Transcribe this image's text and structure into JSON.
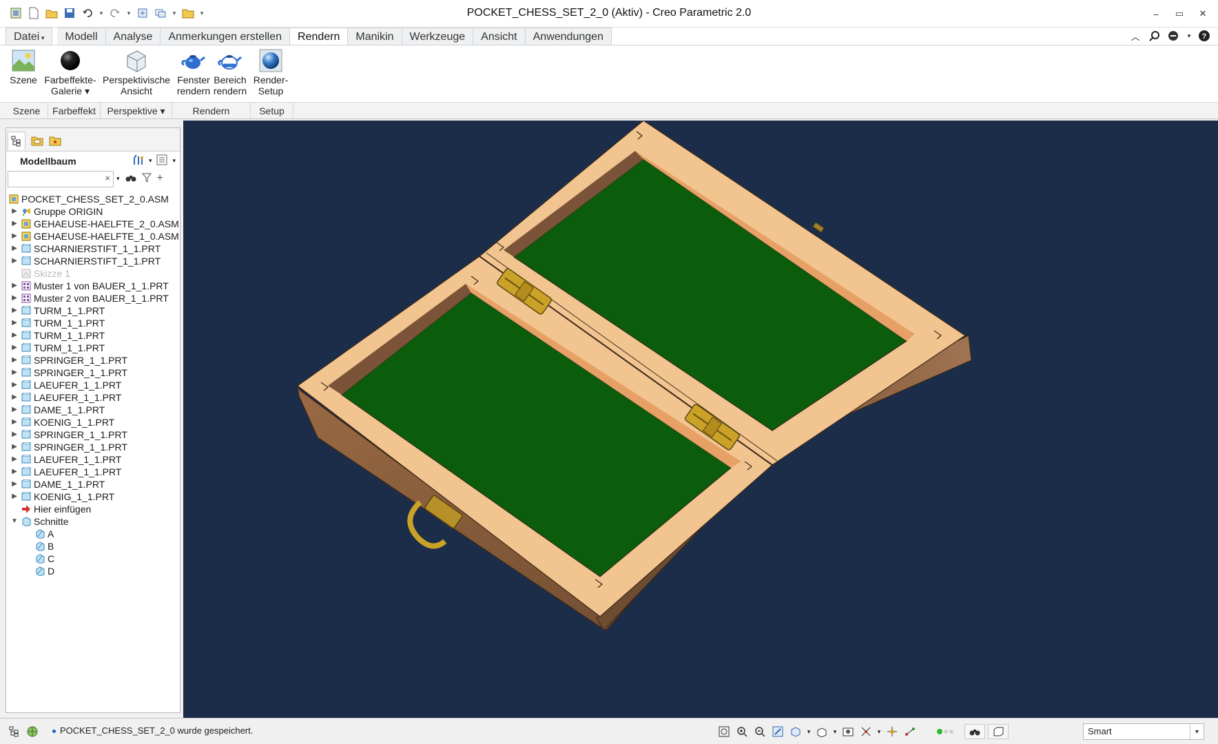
{
  "window": {
    "title": "POCKET_CHESS_SET_2_0 (Aktiv) - Creo Parametric 2.0"
  },
  "ribbon_tabs": [
    {
      "label": "Datei",
      "name": "tab-datei"
    },
    {
      "label": "Modell",
      "name": "tab-modell"
    },
    {
      "label": "Analyse",
      "name": "tab-analyse"
    },
    {
      "label": "Anmerkungen erstellen",
      "name": "tab-anmerkungen"
    },
    {
      "label": "Rendern",
      "name": "tab-rendern"
    },
    {
      "label": "Manikin",
      "name": "tab-manikin"
    },
    {
      "label": "Werkzeuge",
      "name": "tab-werkzeuge"
    },
    {
      "label": "Ansicht",
      "name": "tab-ansicht"
    },
    {
      "label": "Anwendungen",
      "name": "tab-anwendungen"
    }
  ],
  "active_tab": "Rendern",
  "ribbon_buttons": {
    "szene": "Szene",
    "farbeffekte": "Farbeffekte-\nGalerie ▾",
    "perspektivische": "Perspektivische\nAnsicht",
    "fenster_rendern": "Fenster\nrendern",
    "bereich_rendern": "Bereich\nrendern",
    "render_setup": "Render-\nSetup"
  },
  "ribbon_groups": {
    "szene": "Szene",
    "farbeffekt": "Farbeffekt",
    "perspektive": "Perspektive ▾",
    "rendern": "Rendern",
    "setup": "Setup"
  },
  "panel": {
    "title": "Modellbaum",
    "search_value": "",
    "clear": "×"
  },
  "tree": [
    {
      "label": "POCKET_CHESS_SET_2_0.ASM",
      "type": "asm",
      "level": 0,
      "root": true
    },
    {
      "label": "Gruppe ORIGIN",
      "type": "group",
      "level": 1
    },
    {
      "label": "GEHAEUSE-HAELFTE_2_0.ASM",
      "type": "asm",
      "level": 1
    },
    {
      "label": "GEHAEUSE-HAELFTE_1_0.ASM",
      "type": "asm",
      "level": 1
    },
    {
      "label": "SCHARNIERSTIFT_1_1.PRT",
      "type": "prt",
      "level": 1
    },
    {
      "label": "SCHARNIERSTIFT_1_1.PRT",
      "type": "prt",
      "level": 1
    },
    {
      "label": "Skizze 1",
      "type": "sketch",
      "level": 1,
      "dim": true,
      "noexpand": true
    },
    {
      "label": "Muster 1 von BAUER_1_1.PRT",
      "type": "pattern",
      "level": 1
    },
    {
      "label": "Muster 2 von BAUER_1_1.PRT",
      "type": "pattern",
      "level": 1
    },
    {
      "label": "TURM_1_1.PRT",
      "type": "prt",
      "level": 1
    },
    {
      "label": "TURM_1_1.PRT",
      "type": "prt",
      "level": 1
    },
    {
      "label": "TURM_1_1.PRT",
      "type": "prt",
      "level": 1
    },
    {
      "label": "TURM_1_1.PRT",
      "type": "prt",
      "level": 1
    },
    {
      "label": "SPRINGER_1_1.PRT",
      "type": "prt",
      "level": 1
    },
    {
      "label": "SPRINGER_1_1.PRT",
      "type": "prt",
      "level": 1
    },
    {
      "label": "LAEUFER_1_1.PRT",
      "type": "prt",
      "level": 1
    },
    {
      "label": "LAEUFER_1_1.PRT",
      "type": "prt",
      "level": 1
    },
    {
      "label": "DAME_1_1.PRT",
      "type": "prt",
      "level": 1
    },
    {
      "label": "KOENIG_1_1.PRT",
      "type": "prt",
      "level": 1
    },
    {
      "label": "SPRINGER_1_1.PRT",
      "type": "prt",
      "level": 1
    },
    {
      "label": "SPRINGER_1_1.PRT",
      "type": "prt",
      "level": 1
    },
    {
      "label": "LAEUFER_1_1.PRT",
      "type": "prt",
      "level": 1
    },
    {
      "label": "LAEUFER_1_1.PRT",
      "type": "prt",
      "level": 1
    },
    {
      "label": "DAME_1_1.PRT",
      "type": "prt",
      "level": 1
    },
    {
      "label": "KOENIG_1_1.PRT",
      "type": "prt",
      "level": 1
    },
    {
      "label": "Hier einfügen",
      "type": "insert",
      "level": 1,
      "noexpand": true
    },
    {
      "label": "Schnitte",
      "type": "sections",
      "level": 1,
      "expanded": true
    },
    {
      "label": "A",
      "type": "section",
      "level": 2,
      "noexpand": true
    },
    {
      "label": "B",
      "type": "section",
      "level": 2,
      "noexpand": true
    },
    {
      "label": "C",
      "type": "section",
      "level": 2,
      "noexpand": true
    },
    {
      "label": "D",
      "type": "section",
      "level": 2,
      "noexpand": true
    }
  ],
  "status": {
    "message": "POCKET_CHESS_SET_2_0 wurde gespeichert.",
    "filter_value": "Smart"
  },
  "colors": {
    "viewport_bg": "#1b2d49",
    "wood_top": "#f3c58e",
    "wood_side": "#8a5e3b",
    "felt": "#0d5a0d",
    "brass": "#c9a227"
  }
}
